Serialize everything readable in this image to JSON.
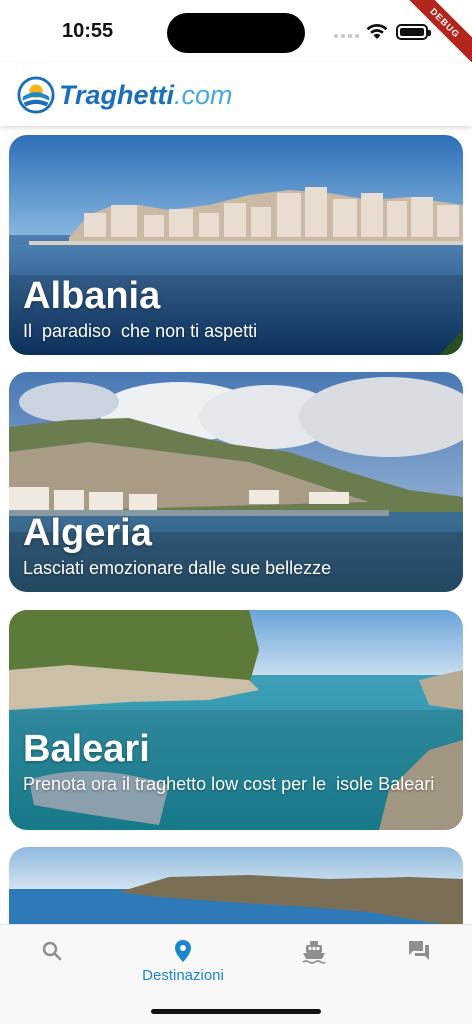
{
  "status_bar": {
    "time": "10:55",
    "debug_label": "DEBUG"
  },
  "header": {
    "logo_bold": "Traghetti",
    "logo_light": ".com"
  },
  "destinations": [
    {
      "title": "Albania",
      "subtitle": "Il  paradiso  che non ti aspetti"
    },
    {
      "title": "Algeria",
      "subtitle": "Lasciati emozionare dalle sue bellezze"
    },
    {
      "title": "Baleari",
      "subtitle": "Prenota ora il traghetto low cost per le  isole Baleari"
    },
    {
      "title": "",
      "subtitle": ""
    }
  ],
  "bottom_nav": {
    "items": [
      {
        "icon": "search-icon",
        "label": ""
      },
      {
        "icon": "location-pin-icon",
        "label": "Destinazioni",
        "active": true
      },
      {
        "icon": "ferry-icon",
        "label": ""
      },
      {
        "icon": "chat-icon",
        "label": ""
      }
    ]
  },
  "colors": {
    "accent": "#1b87c9",
    "logo_blue": "#1b6fb8",
    "logo_light": "#4aa7e0",
    "inactive": "#8e8e93"
  }
}
